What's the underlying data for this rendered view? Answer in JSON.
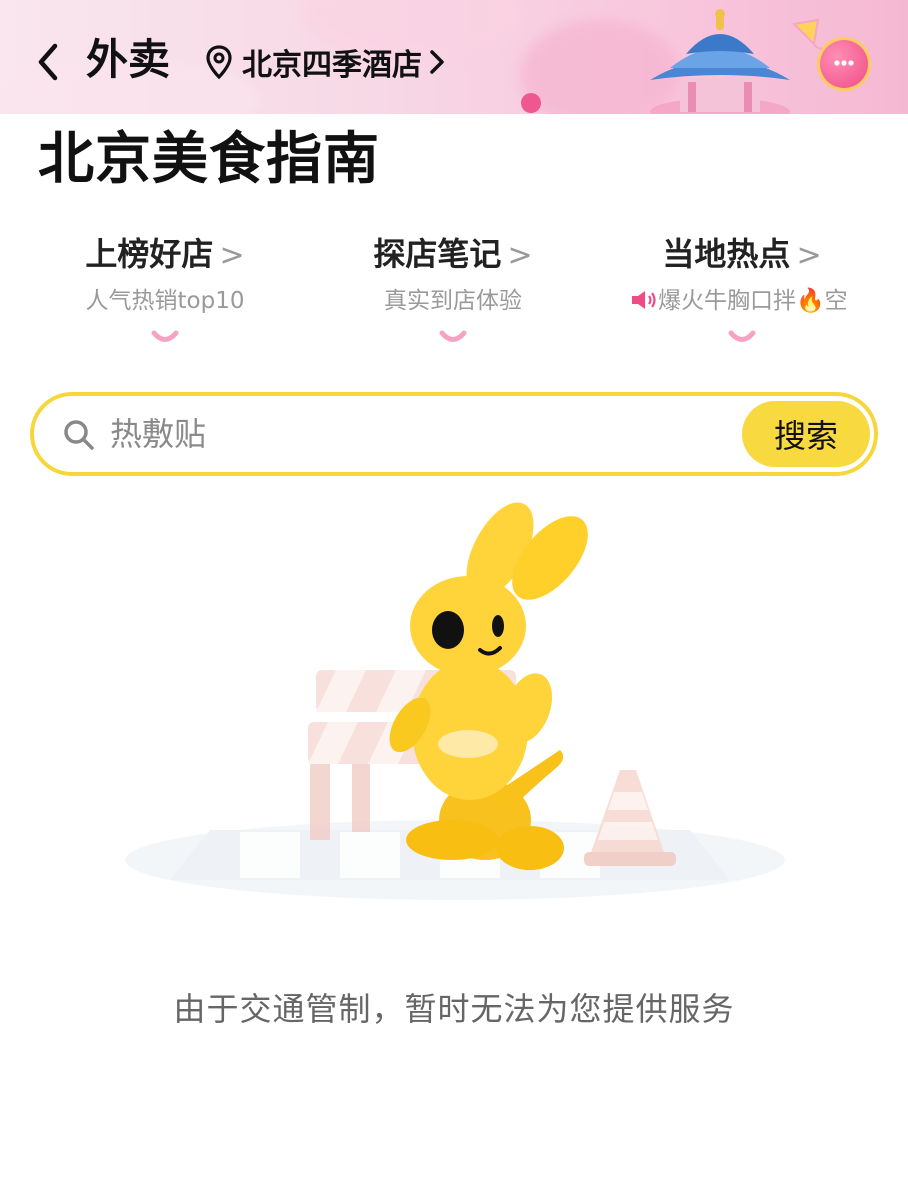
{
  "header": {
    "back_icon": "chevron-left-icon",
    "title": "外卖",
    "location_icon": "map-pin-icon",
    "location": "北京四季酒店",
    "location_chevron": ">",
    "message_icon": "chat-bubble-icon",
    "accent_color": "#f7d63a",
    "brand_pink": "#ef4b86"
  },
  "page_title": "北京美食指南",
  "entries": [
    {
      "title": "上榜好店",
      "chevron": ">",
      "subtitle": "人气热销top10"
    },
    {
      "title": "探店笔记",
      "chevron": ">",
      "subtitle": "真实到店体验"
    },
    {
      "title": "当地热点",
      "chevron": ">",
      "subtitle_icon": "speaker-icon",
      "subtitle": "爆火牛胸口拌🔥空"
    }
  ],
  "search": {
    "icon": "search-icon",
    "placeholder": "热敷贴",
    "button_label": "搜索"
  },
  "empty_state": {
    "illustration": "yellow-kangaroo-mascot-with-roadblock-and-traffic-cone",
    "message": "由于交通管制，暂时无法为您提供服务"
  }
}
